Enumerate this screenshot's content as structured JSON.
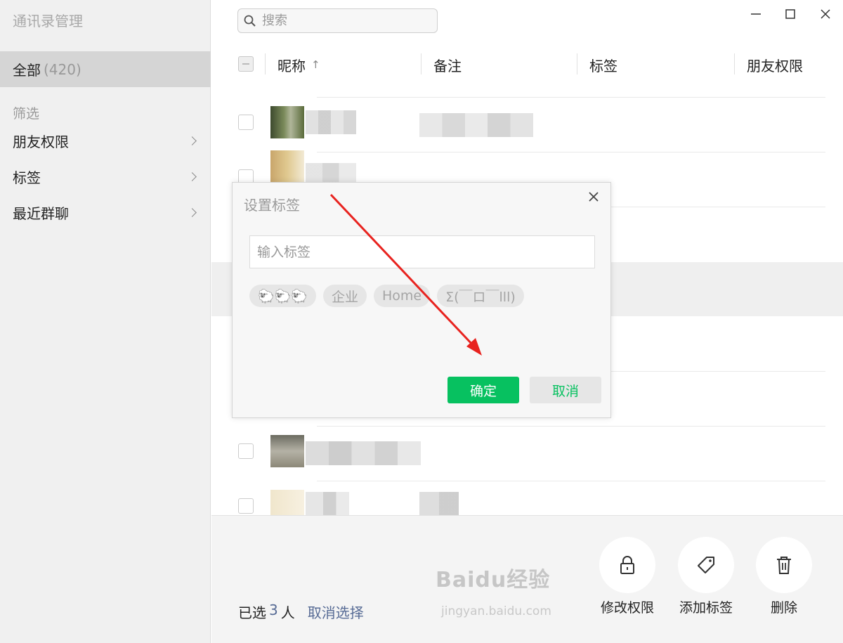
{
  "app": {
    "title": "通讯录管理"
  },
  "sidebar": {
    "all": {
      "label": "全部",
      "count": "(420)"
    },
    "filter_header": "筛选",
    "items": [
      {
        "label": "朋友权限"
      },
      {
        "label": "标签"
      },
      {
        "label": "最近群聊"
      }
    ]
  },
  "search": {
    "placeholder": "搜索"
  },
  "table": {
    "columns": [
      "昵称",
      "备注",
      "标签",
      "朋友权限"
    ],
    "sort_indicator": "↑"
  },
  "bottom": {
    "selected_prefix": "已选",
    "selected_count": "3",
    "selected_suffix": "人",
    "deselect_link": "取消选择",
    "actions": [
      {
        "label": "修改权限",
        "icon": "lock-icon"
      },
      {
        "label": "添加标签",
        "icon": "tag-icon"
      },
      {
        "label": "删除",
        "icon": "trash-icon"
      }
    ]
  },
  "dialog": {
    "title": "设置标签",
    "input_placeholder": "输入标签",
    "tags": [
      "🐑🐑🐑",
      "企业",
      "Home",
      "Σ(￣ロ￣lll)"
    ],
    "ok_label": "确定",
    "cancel_label": "取消"
  },
  "watermark": {
    "main": "Baidu经验",
    "sub": "jingyan.baidu.com"
  },
  "colors": {
    "accent_green": "#07c160",
    "link_blue": "#576b95",
    "arrow_red": "#e8231f"
  }
}
